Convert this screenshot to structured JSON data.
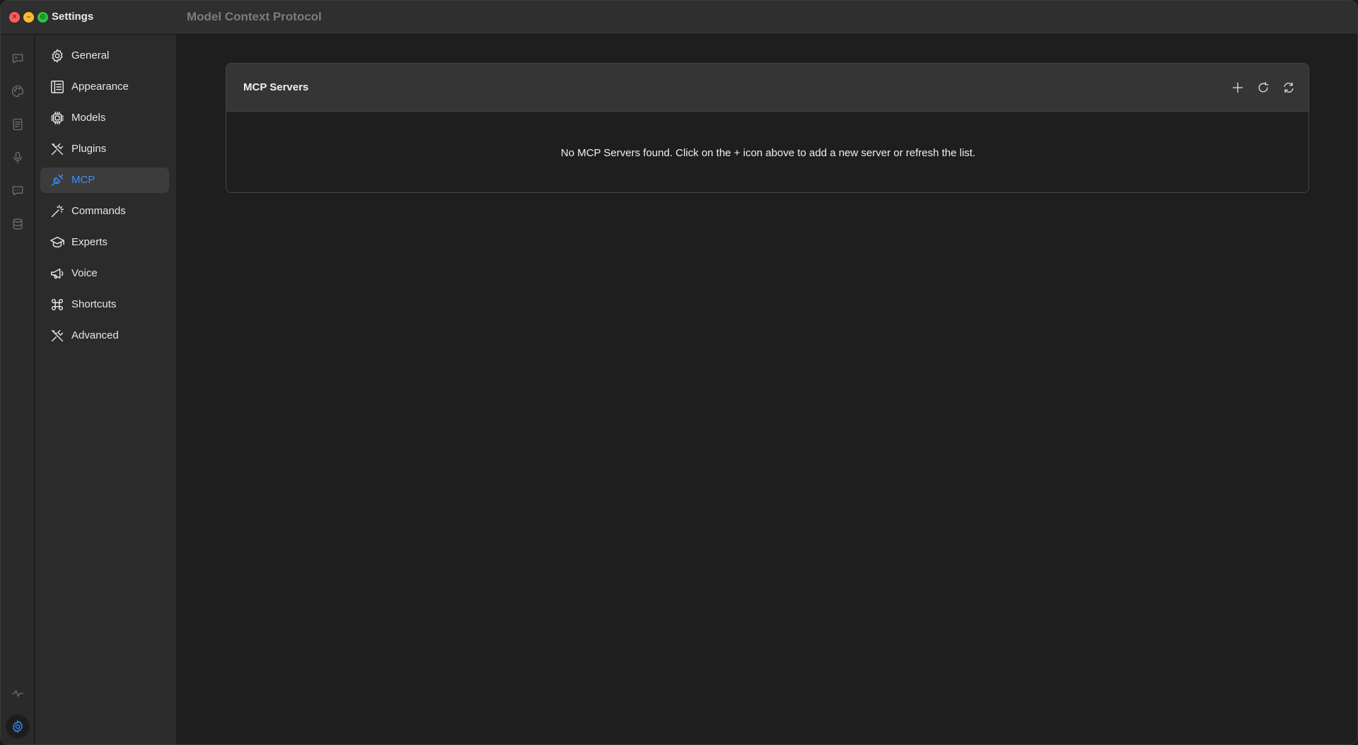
{
  "window": {
    "app_title": "Settings",
    "page_heading": "Model Context Protocol"
  },
  "rail": {
    "icons": [
      "chat-icon",
      "palette-icon",
      "document-icon",
      "microphone-icon",
      "message-icon",
      "database-icon",
      "activity-icon",
      "gear-icon"
    ]
  },
  "sidebar": {
    "items": [
      {
        "label": "General",
        "icon": "gear-icon"
      },
      {
        "label": "Appearance",
        "icon": "layout-icon"
      },
      {
        "label": "Models",
        "icon": "chip-icon"
      },
      {
        "label": "Plugins",
        "icon": "tools-icon"
      },
      {
        "label": "MCP",
        "icon": "plug-icon",
        "active": true
      },
      {
        "label": "Commands",
        "icon": "magic-wand-icon"
      },
      {
        "label": "Experts",
        "icon": "graduation-cap-icon"
      },
      {
        "label": "Voice",
        "icon": "megaphone-icon"
      },
      {
        "label": "Shortcuts",
        "icon": "command-icon"
      },
      {
        "label": "Advanced",
        "icon": "tools-icon"
      }
    ]
  },
  "mcp": {
    "title": "MCP Servers",
    "empty_message": "No MCP Servers found. Click on the + icon above to add a new server or refresh the list.",
    "actions": [
      "plus-icon",
      "reload-icon",
      "sync-icon"
    ]
  },
  "colors": {
    "accent": "#3d8cf7",
    "close": "#ff5f57",
    "minimize": "#febc2e",
    "maximize": "#28c840"
  }
}
